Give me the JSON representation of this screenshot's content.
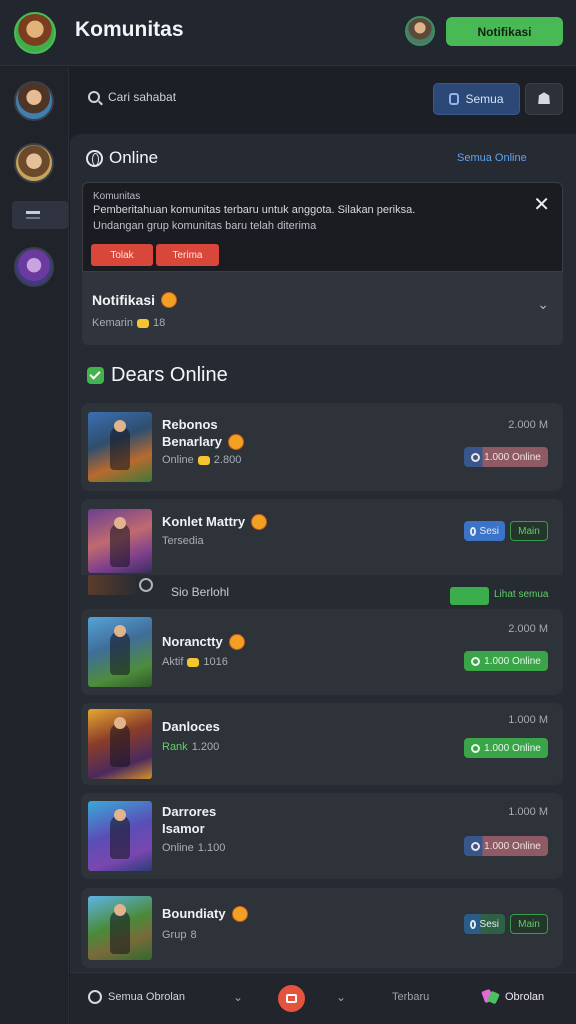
{
  "app": {
    "title": "Komunitas",
    "header_button": "Notifikasi"
  },
  "toolbar": {
    "search_label": "Cari sahabat",
    "filter_button": "Semua"
  },
  "online_section": {
    "title": "Online",
    "link": "Semua Online"
  },
  "notice": {
    "line1": "Komunitas",
    "line2": "Pemberitahuan komunitas terbaru untuk anggota. Silakan periksa.",
    "line3": "Undangan grup komunitas baru telah diterima",
    "button1": "Tolak",
    "button2": "Terima"
  },
  "notification": {
    "name": "Notifikasi",
    "sub": "Kemarin",
    "count": "18"
  },
  "friends_section": {
    "title": "Dears Online"
  },
  "friends": [
    {
      "name_line1": "Rebonos",
      "name_line2": "Benarlary",
      "status": "Online",
      "coins": "2.800",
      "time": "2.000 M",
      "pill1": "1.000 Online"
    },
    {
      "name_line1": "Konlet Mattry",
      "status": "Tersedia",
      "pill1": "Sesi",
      "pill2": "Main"
    },
    {
      "name_line1": "Noranctty",
      "status": "Aktif",
      "coins": "1016",
      "time": "2.000 M",
      "pill1": "1.000 Online"
    },
    {
      "name_line1": "Danloces",
      "status": "Rank",
      "coins": "1.200",
      "time": "1.000 M",
      "pill1": "1.000 Online"
    },
    {
      "name_line1": "Darrores",
      "name_line2": "Isamor",
      "status": "Online",
      "coins": "1.100",
      "time": "1.000 M",
      "pill1": "1.000 Online"
    },
    {
      "name_line1": "Boundiaty",
      "status": "Grup",
      "coins": "8",
      "pill1": "Sesi",
      "pill2": "Main"
    }
  ],
  "divider": {
    "label": "Sio Berlohl",
    "link": "Lihat semua"
  },
  "bottombar": {
    "left_label": "Semua Obrolan",
    "recent": "Terbaru",
    "messages": "Obrolan"
  },
  "colors": {
    "accent_green": "#49b955",
    "accent_red": "#e5533f",
    "accent_blue": "#2b4876",
    "background": "#1c1f26"
  },
  "icons": {
    "search": "search-icon",
    "filter": "filter-icon",
    "people": "people-icon",
    "globe": "globe-icon",
    "close": "close-icon",
    "chevron": "chevron-down-icon",
    "check": "check-icon",
    "messages": "messages-icon"
  }
}
